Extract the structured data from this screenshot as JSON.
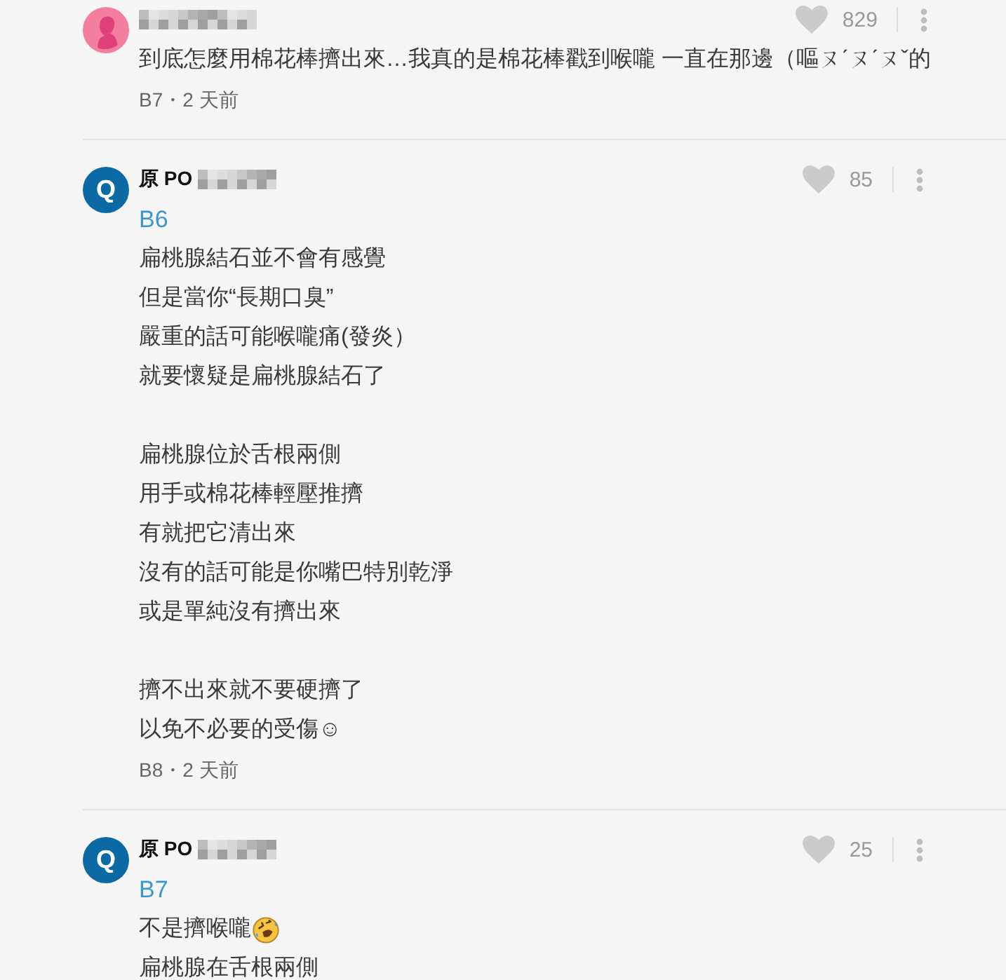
{
  "comments": [
    {
      "avatar": {
        "kind": "silhouette",
        "color": "#f27ea0"
      },
      "name_blurred": true,
      "likes": "829",
      "paragraphs": [
        {
          "lines": [
            {
              "text": "到底怎麼用棉花棒擠出來…我真的是棉花棒戳到喉嚨 一直在那邊（嘔ㄡˊㄡˊㄡˇ的",
              "emoji": false
            }
          ]
        }
      ],
      "footer": "B7・2 天前"
    },
    {
      "avatar": {
        "kind": "letter",
        "letter": "Q",
        "color": "#0b6aa4"
      },
      "author": "原 PO",
      "name_blurred": true,
      "likes": "85",
      "reply_tag": "B6",
      "paragraphs": [
        {
          "lines": [
            {
              "text": "扁桃腺結石並不會有感覺",
              "emoji": false
            },
            {
              "text": "但是當你“長期口臭”",
              "emoji": false
            },
            {
              "text": "嚴重的話可能喉嚨痛(發炎）",
              "emoji": false
            },
            {
              "text": "就要懷疑是扁桃腺結石了",
              "emoji": false
            }
          ]
        },
        {
          "lines": [
            {
              "text": "扁桃腺位於舌根兩側",
              "emoji": false
            },
            {
              "text": "用手或棉花棒輕壓推擠",
              "emoji": false
            },
            {
              "text": "有就把它清出來",
              "emoji": false
            },
            {
              "text": "沒有的話可能是你嘴巴特別乾淨",
              "emoji": false
            },
            {
              "text": "或是單純沒有擠出來",
              "emoji": false
            }
          ]
        },
        {
          "lines": [
            {
              "text": "擠不出來就不要硬擠了",
              "emoji": false
            },
            {
              "text": "以免不必要的受傷☺",
              "emoji": false
            }
          ]
        }
      ],
      "footer": "B8・2 天前"
    },
    {
      "avatar": {
        "kind": "letter",
        "letter": "Q",
        "color": "#0b6aa4"
      },
      "author": "原 PO",
      "name_blurred": true,
      "likes": "25",
      "reply_tag": "B7",
      "paragraphs": [
        {
          "lines": [
            {
              "text": "不是擠喉嚨",
              "emoji": true
            },
            {
              "text": "扁桃腺在舌根兩側",
              "emoji": false
            }
          ]
        }
      ]
    }
  ]
}
